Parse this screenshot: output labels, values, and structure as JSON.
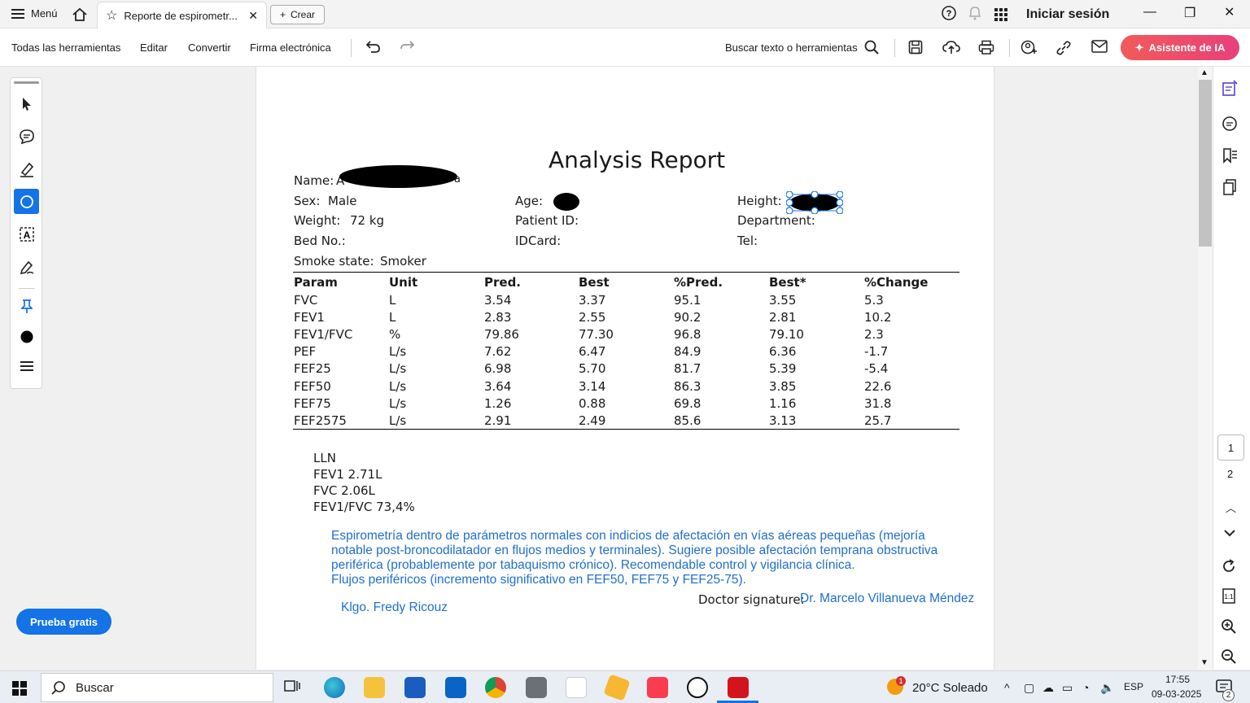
{
  "titlebar": {
    "menu_label": "Menú",
    "tab_title": "Reporte de espirometr...",
    "create_label": "Crear",
    "signin_label": "Iniciar sesión"
  },
  "toolbar": {
    "all_tools": "Todas las herramientas",
    "edit": "Editar",
    "convert": "Convertir",
    "esign": "Firma electrónica",
    "search_label": "Buscar texto o herramientas",
    "ai_assistant": "Asistente de IA"
  },
  "left": {
    "trial_button": "Prueba gratis"
  },
  "right": {
    "page_current": "1",
    "page_next": "2"
  },
  "report": {
    "title": "Analysis Report",
    "name_label": "Name:",
    "name_value_initial": "A",
    "name_value_tail": "a",
    "sex_label": "Sex:",
    "sex_value": "Male",
    "age_label": "Age:",
    "height_label": "Height:",
    "weight_label": "Weight:",
    "weight_value": "72 kg",
    "patient_id_label": "Patient ID:",
    "department_label": "Department:",
    "bed_label": "Bed No.:",
    "idcard_label": "IDCard:",
    "tel_label": "Tel:",
    "smoke_label": "Smoke state:",
    "smoke_value": "Smoker",
    "table_headers": [
      "Param",
      "Unit",
      "Pred.",
      "Best",
      "%Pred.",
      "Best*",
      "%Change"
    ],
    "table_rows": [
      [
        "FVC",
        "L",
        "3.54",
        "3.37",
        "95.1",
        "3.55",
        "5.3"
      ],
      [
        "FEV1",
        "L",
        "2.83",
        "2.55",
        "90.2",
        "2.81",
        "10.2"
      ],
      [
        "FEV1/FVC",
        "%",
        "79.86",
        "77.30",
        "96.8",
        "79.10",
        "2.3"
      ],
      [
        "PEF",
        "L/s",
        "7.62",
        "6.47",
        "84.9",
        "6.36",
        "-1.7"
      ],
      [
        "FEF25",
        "L/s",
        "6.98",
        "5.70",
        "81.7",
        "5.39",
        "-5.4"
      ],
      [
        "FEF50",
        "L/s",
        "3.64",
        "3.14",
        "86.3",
        "3.85",
        "22.6"
      ],
      [
        "FEF75",
        "L/s",
        "1.26",
        "0.88",
        "69.8",
        "1.16",
        "31.8"
      ],
      [
        "FEF2575",
        "L/s",
        "2.91",
        "2.49",
        "85.6",
        "3.13",
        "25.7"
      ]
    ],
    "lln_lines": [
      "LLN",
      "FEV1 2.71L",
      "FVC 2.06L",
      "FEV1/FVC 73,4%"
    ],
    "comment_lines": [
      "Espirometría dentro de parámetros normales con indicios de afectación en vías aéreas pequeñas (mejoría",
      "notable post-broncodilatador en flujos medios y terminales). Sugiere posible afectación temprana obstructiva",
      "periférica (probablemente por tabaquismo crónico). Recomendable control y vigilancia clínica.",
      "Flujos periféricos (incremento significativo en FEF50, FEF75 y FEF25-75)."
    ],
    "technician": "Klgo. Fredy Ricouz",
    "doctor_label": "Doctor signature:",
    "doctor_name": "Dr. Marcelo Villanueva Méndez"
  },
  "taskbar": {
    "search_placeholder": "Buscar",
    "weather": "20°C Soleado",
    "weather_badge": "1",
    "lang": "ESP",
    "time": "17:55",
    "date": "09-03-2025",
    "notif_count": "2"
  },
  "colors": {
    "accent": "#1473e6",
    "comment_blue": "#1f6fcc",
    "ai_gradient_start": "#f25a5a",
    "ai_gradient_end": "#e8407a"
  }
}
